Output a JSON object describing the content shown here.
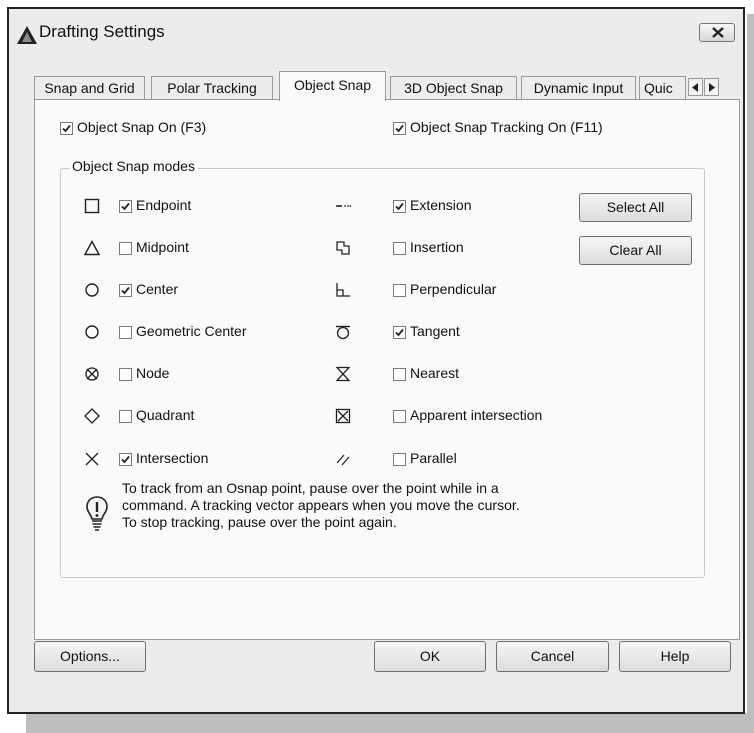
{
  "window": {
    "title": "Drafting Settings",
    "close_icon": "close-x-icon"
  },
  "tabs": [
    {
      "label": "Snap and Grid",
      "active": false
    },
    {
      "label": "Polar Tracking",
      "active": false
    },
    {
      "label": "Object Snap",
      "active": true
    },
    {
      "label": "3D Object Snap",
      "active": false
    },
    {
      "label": "Dynamic Input",
      "active": false
    },
    {
      "label": "Quic",
      "active": false
    }
  ],
  "object_snap_on": {
    "label": "Object Snap On (F3)",
    "checked": true
  },
  "object_snap_tracking_on": {
    "label": "Object Snap Tracking On (F11)",
    "checked": true
  },
  "modes_group": {
    "title": "Object Snap modes"
  },
  "modes_left": [
    {
      "label": "Endpoint",
      "checked": true,
      "icon": "endpoint-square-icon"
    },
    {
      "label": "Midpoint",
      "checked": false,
      "icon": "midpoint-triangle-icon"
    },
    {
      "label": "Center",
      "checked": true,
      "icon": "center-circle-icon"
    },
    {
      "label": "Geometric Center",
      "checked": false,
      "icon": "geometric-center-icon"
    },
    {
      "label": "Node",
      "checked": false,
      "icon": "node-icon"
    },
    {
      "label": "Quadrant",
      "checked": false,
      "icon": "quadrant-diamond-icon"
    },
    {
      "label": "Intersection",
      "checked": true,
      "icon": "intersection-x-icon"
    }
  ],
  "modes_right": [
    {
      "label": "Extension",
      "checked": true,
      "icon": "extension-icon"
    },
    {
      "label": "Insertion",
      "checked": false,
      "icon": "insertion-icon"
    },
    {
      "label": "Perpendicular",
      "checked": false,
      "icon": "perpendicular-icon"
    },
    {
      "label": "Tangent",
      "checked": true,
      "icon": "tangent-icon"
    },
    {
      "label": "Nearest",
      "checked": false,
      "icon": "nearest-hourglass-icon"
    },
    {
      "label": "Apparent intersection",
      "checked": false,
      "icon": "apparent-intersection-icon"
    },
    {
      "label": "Parallel",
      "checked": false,
      "icon": "parallel-icon"
    }
  ],
  "buttons": {
    "select_all": "Select All",
    "clear_all": "Clear All",
    "options": "Options...",
    "ok": "OK",
    "cancel": "Cancel",
    "help": "Help"
  },
  "hint": {
    "icon": "lightbulb-icon",
    "text": "To track from an Osnap point, pause over the point while in a\ncommand.  A tracking vector appears when you move the cursor.\nTo stop tracking, pause over the point again."
  }
}
